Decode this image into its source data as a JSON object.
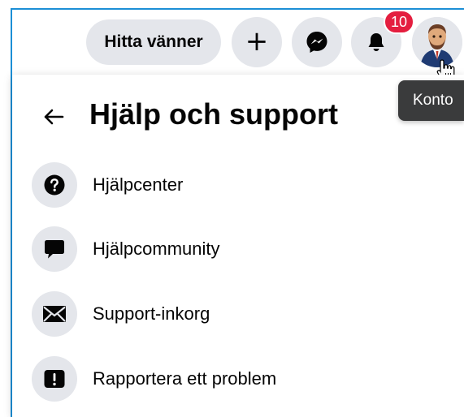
{
  "topbar": {
    "find_friends_label": "Hitta vänner",
    "create_icon": "plus-icon",
    "messenger_icon": "messenger-icon",
    "notifications_icon": "bell-icon",
    "notification_count": "10",
    "account_icon": "avatar"
  },
  "tooltip": {
    "text": "Konto"
  },
  "panel": {
    "back_icon": "arrow-left-icon",
    "title": "Hjälp och support",
    "items": [
      {
        "icon": "question-circle-icon",
        "label": "Hjälpcenter"
      },
      {
        "icon": "speech-bubble-icon",
        "label": "Hjälpcommunity"
      },
      {
        "icon": "envelope-icon",
        "label": "Support-inkorg"
      },
      {
        "icon": "exclamation-square-icon",
        "label": "Rapportera ett problem"
      }
    ]
  },
  "colors": {
    "badge": "#e41e3f",
    "button_bg": "#e4e6eb",
    "tooltip_bg": "#3a3b3c",
    "window_border": "#1c8fd6"
  }
}
